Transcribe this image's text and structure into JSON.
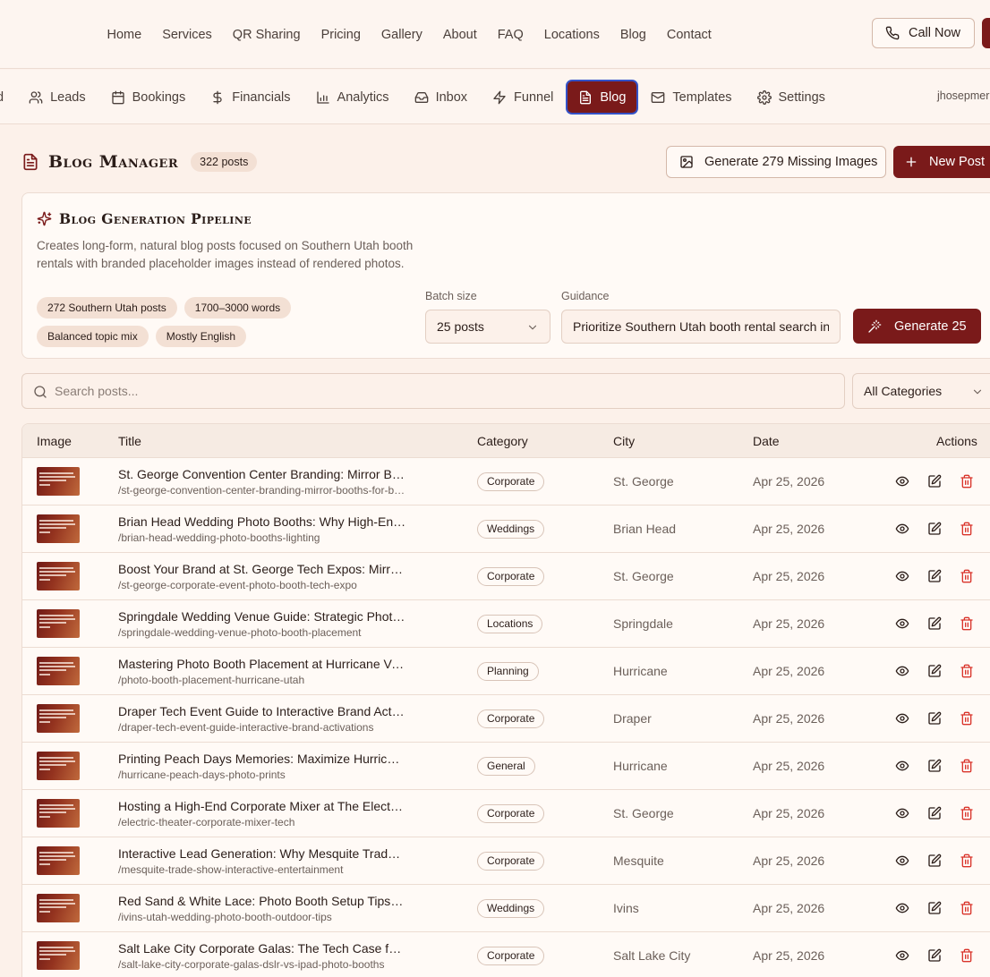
{
  "top_nav": {
    "links": [
      "Home",
      "Services",
      "QR Sharing",
      "Pricing",
      "Gallery",
      "About",
      "FAQ",
      "Locations",
      "Blog",
      "Contact"
    ],
    "call_label": "Call Now"
  },
  "admin_nav": {
    "items": [
      {
        "label": "d",
        "icon": "none"
      },
      {
        "label": "Leads",
        "icon": "users-icon"
      },
      {
        "label": "Bookings",
        "icon": "calendar-icon"
      },
      {
        "label": "Financials",
        "icon": "dollar-icon"
      },
      {
        "label": "Analytics",
        "icon": "bar-chart-icon"
      },
      {
        "label": "Inbox",
        "icon": "inbox-icon"
      },
      {
        "label": "Funnel",
        "icon": "zap-icon"
      },
      {
        "label": "Blog",
        "icon": "file-text-icon",
        "active": true
      },
      {
        "label": "Templates",
        "icon": "mail-icon"
      },
      {
        "label": "Settings",
        "icon": "gear-icon"
      }
    ],
    "username": "jhosepmer"
  },
  "header": {
    "title": "Blog Manager",
    "post_count": "322 posts",
    "generate_images_label": "Generate 279 Missing Images",
    "new_post_label": "New Post"
  },
  "pipeline": {
    "title": "Blog Generation Pipeline",
    "description": "Creates long-form, natural blog posts focused on Southern Utah booth rentals with branded placeholder images instead of rendered photos.",
    "tags": [
      "272 Southern Utah posts",
      "1700–3000 words",
      "Balanced topic mix",
      "Mostly English"
    ],
    "batch_label": "Batch size",
    "batch_value": "25 posts",
    "guidance_label": "Guidance",
    "guidance_value": "Prioritize Southern Utah booth rental search intent",
    "generate_label": "Generate 25"
  },
  "search": {
    "placeholder": "Search posts...",
    "category_value": "All Categories"
  },
  "table": {
    "columns": [
      "Image",
      "Title",
      "Category",
      "City",
      "Date",
      "Actions"
    ],
    "rows": [
      {
        "title": "St. George Convention Center Branding: Mirror Booths for Brands",
        "slug": "/st-george-convention-center-branding-mirror-booths-for-brands",
        "category": "Corporate",
        "city": "St. George",
        "date": "Apr 25, 2026"
      },
      {
        "title": "Brian Head Wedding Photo Booths: Why High-End Lighting Matters",
        "slug": "/brian-head-wedding-photo-booths-lighting",
        "category": "Weddings",
        "city": "Brian Head",
        "date": "Apr 25, 2026"
      },
      {
        "title": "Boost Your Brand at St. George Tech Expos: Mirror Booths",
        "slug": "/st-george-corporate-event-photo-booth-tech-expo",
        "category": "Corporate",
        "city": "St. George",
        "date": "Apr 25, 2026"
      },
      {
        "title": "Springdale Wedding Venue Guide: Strategic Photo Booth Placement",
        "slug": "/springdale-wedding-venue-photo-booth-placement",
        "category": "Locations",
        "city": "Springdale",
        "date": "Apr 25, 2026"
      },
      {
        "title": "Mastering Photo Booth Placement at Hurricane Venues",
        "slug": "/photo-booth-placement-hurricane-utah",
        "category": "Planning",
        "city": "Hurricane",
        "date": "Apr 25, 2026"
      },
      {
        "title": "Draper Tech Event Guide to Interactive Brand Activations",
        "slug": "/draper-tech-event-guide-interactive-brand-activations",
        "category": "Corporate",
        "city": "Draper",
        "date": "Apr 25, 2026"
      },
      {
        "title": "Printing Peach Days Memories: Maximize Hurricane Prints",
        "slug": "/hurricane-peach-days-photo-prints",
        "category": "General",
        "city": "Hurricane",
        "date": "Apr 25, 2026"
      },
      {
        "title": "Hosting a High-End Corporate Mixer at The Electric Theater",
        "slug": "/electric-theater-corporate-mixer-tech",
        "category": "Corporate",
        "city": "St. George",
        "date": "Apr 25, 2026"
      },
      {
        "title": "Interactive Lead Generation: Why Mesquite Trade Shows Need Booths",
        "slug": "/mesquite-trade-show-interactive-entertainment",
        "category": "Corporate",
        "city": "Mesquite",
        "date": "Apr 25, 2026"
      },
      {
        "title": "Red Sand & White Lace: Photo Booth Setup Tips for Ivins",
        "slug": "/ivins-utah-wedding-photo-booth-outdoor-tips",
        "category": "Weddings",
        "city": "Ivins",
        "date": "Apr 25, 2026"
      },
      {
        "title": "Salt Lake City Corporate Galas: The Tech Case for Mirror Booths",
        "slug": "/salt-lake-city-corporate-galas-dslr-vs-ipad-photo-booths",
        "category": "Corporate",
        "city": "Salt Lake City",
        "date": "Apr 25, 2026"
      }
    ]
  },
  "colors": {
    "accent": "#7a1a1a",
    "delete": "#d9342b",
    "background": "#fcf1ea",
    "focus_ring": "#3452c8"
  }
}
